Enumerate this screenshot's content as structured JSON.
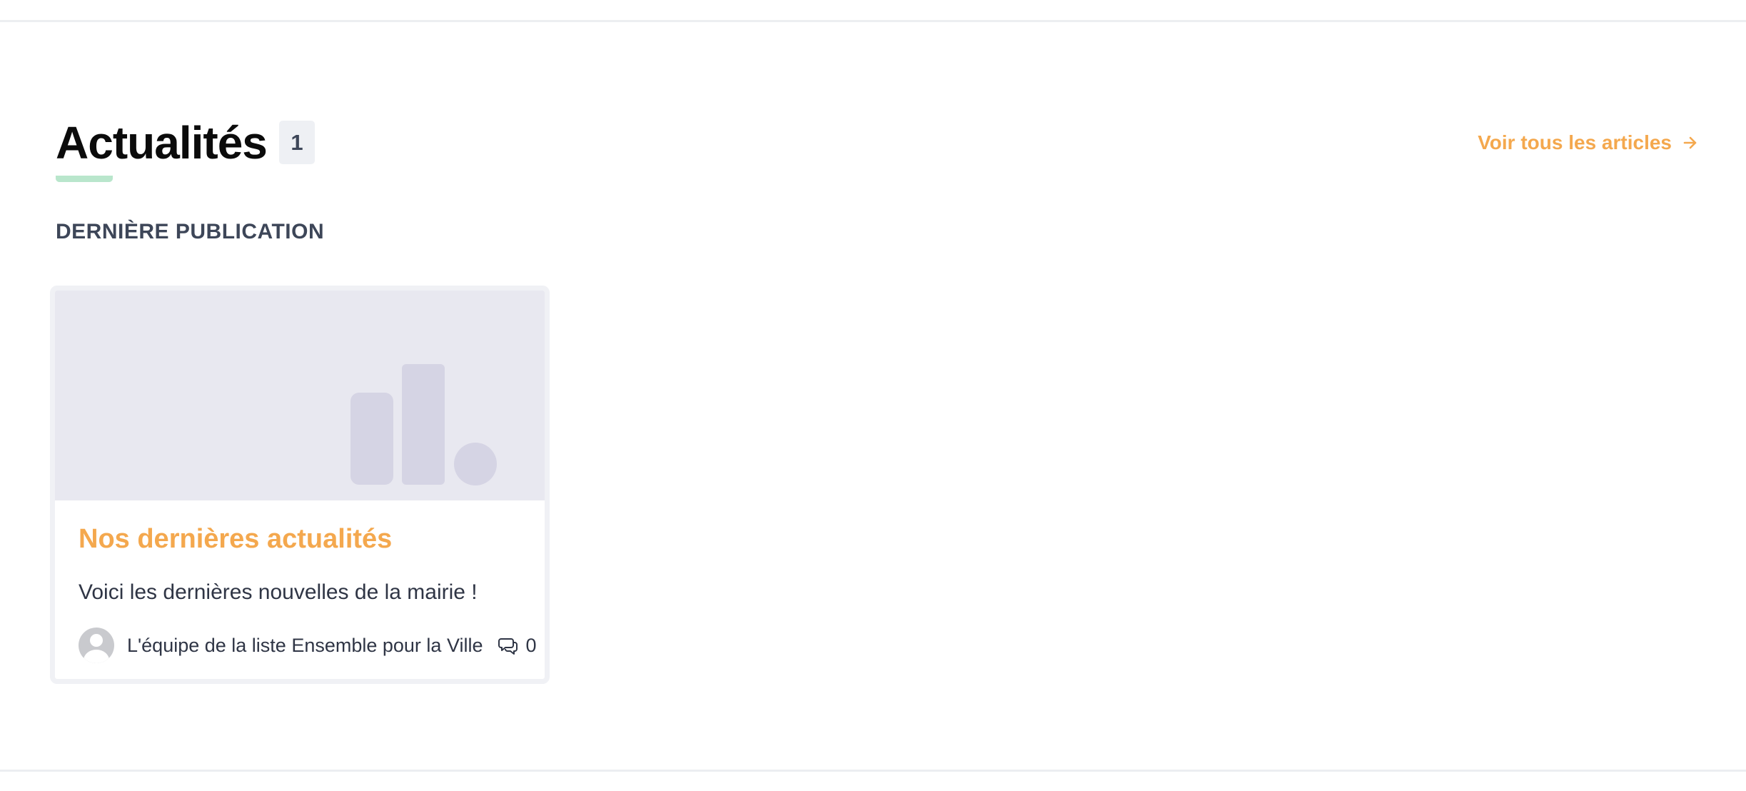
{
  "section": {
    "title": "Actualités",
    "count": "1",
    "see_all_label": "Voir tous les articles",
    "subheading": "DERNIÈRE PUBLICATION"
  },
  "article": {
    "title": "Nos dernières actualités",
    "excerpt": "Voici les dernières nouvelles de la mairie !",
    "author": "L'équipe de la liste Ensemble pour la Ville",
    "comment_count": "0"
  },
  "icons": {
    "see_all": "arrow-right-icon",
    "comments": "comment-bubbles-icon",
    "avatar": "default-user-avatar",
    "placeholder": "placeholder-logo"
  },
  "colors": {
    "accent": "#f4a84e",
    "underline": "#b9e6cc",
    "text": "#2f3545",
    "placeholder_bg": "#e8e8f0",
    "placeholder_shape": "#d5d4e4"
  }
}
